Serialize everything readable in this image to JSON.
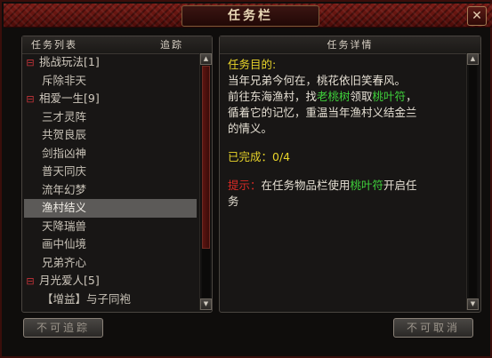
{
  "window": {
    "title": "任务栏",
    "close_glyph": "✕"
  },
  "quest_list": {
    "header_left": "任务列表",
    "header_right": "追踪",
    "rows": [
      {
        "type": "group",
        "label": "挑战玩法[1]",
        "toggle": "⊟"
      },
      {
        "type": "child",
        "label": "斥除非天"
      },
      {
        "type": "group",
        "label": "相爱一生[9]",
        "toggle": "⊟"
      },
      {
        "type": "child",
        "label": "三才灵阵"
      },
      {
        "type": "child",
        "label": "共贺良辰"
      },
      {
        "type": "child",
        "label": "剑指凶神"
      },
      {
        "type": "child",
        "label": "普天同庆"
      },
      {
        "type": "child",
        "label": "流年幻梦"
      },
      {
        "type": "child",
        "label": "渔村结义",
        "selected": true
      },
      {
        "type": "child",
        "label": "天降瑞兽"
      },
      {
        "type": "child",
        "label": "画中仙境"
      },
      {
        "type": "child",
        "label": "兄弟齐心"
      },
      {
        "type": "group",
        "label": "月光爱人[5]",
        "toggle": "⊟"
      },
      {
        "type": "child",
        "label": "【增益】与子同袍"
      }
    ]
  },
  "quest_detail": {
    "header": "任务详情",
    "objective_label": "任务目的:",
    "line1": "当年兄弟今何在，桃花依旧笑春风。",
    "line2_a": "前往东海渔村，找",
    "line2_npc": "老桃树",
    "line2_b": "领取",
    "line2_item": "桃叶符",
    "line2_c": "，",
    "line3": "循着它的记忆，重温当年渔村义结金兰",
    "line4": "的情义。",
    "completed_label": "已完成：",
    "completed_value": "0/4",
    "hint_label": "提示：",
    "hint_a": "在任务物品栏使用",
    "hint_item": "桃叶符",
    "hint_b": "开启任",
    "hint_c": "务"
  },
  "buttons": {
    "left": "不可追踪",
    "right": "不可取消"
  },
  "colors": {
    "frame_red": "#6b1510",
    "highlight_green": "#3fd13b",
    "label_yellow": "#e8d42a",
    "hint_red": "#d62a25",
    "selected_row": "#5c5a58"
  }
}
